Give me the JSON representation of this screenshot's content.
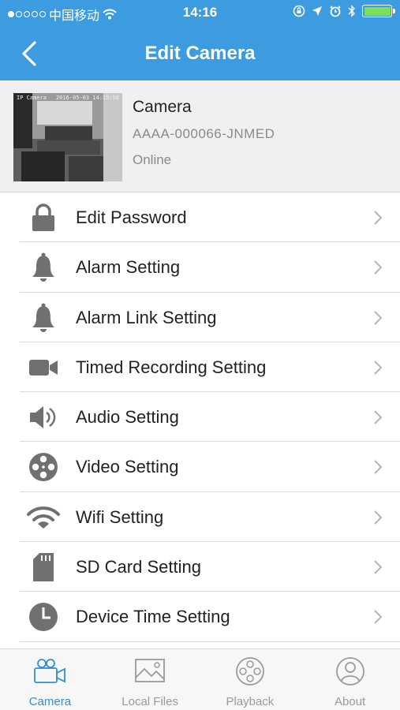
{
  "status_bar": {
    "carrier": "中国移动",
    "time": "14:16"
  },
  "nav": {
    "title": "Edit Camera"
  },
  "camera": {
    "name": "Camera",
    "id": "AAAA-000066-JNMED",
    "status": "Online",
    "thumb_timestamp": "2016-05-03 14:15:56",
    "thumb_label": "IP Camera"
  },
  "menu": [
    {
      "label": "Edit Password",
      "icon": "lock-icon"
    },
    {
      "label": "Alarm Setting",
      "icon": "bell-icon"
    },
    {
      "label": "Alarm Link Setting",
      "icon": "bell-icon"
    },
    {
      "label": "Timed Recording Setting",
      "icon": "video-camera-icon"
    },
    {
      "label": "Audio Setting",
      "icon": "speaker-icon"
    },
    {
      "label": "Video Setting",
      "icon": "film-reel-icon"
    },
    {
      "label": "Wifi Setting",
      "icon": "wifi-icon"
    },
    {
      "label": "SD Card Setting",
      "icon": "sd-card-icon"
    },
    {
      "label": "Device Time Setting",
      "icon": "clock-icon"
    }
  ],
  "tabs": [
    {
      "label": "Camera",
      "icon": "camera-tab-icon",
      "active": true
    },
    {
      "label": "Local Files",
      "icon": "image-icon",
      "active": false
    },
    {
      "label": "Playback",
      "icon": "playback-icon",
      "active": false
    },
    {
      "label": "About",
      "icon": "person-icon",
      "active": false
    }
  ],
  "colors": {
    "header": "#3d9be0",
    "active_tab": "#2f8fd8",
    "icon_gray": "#707070",
    "battery": "#7ee05a"
  }
}
